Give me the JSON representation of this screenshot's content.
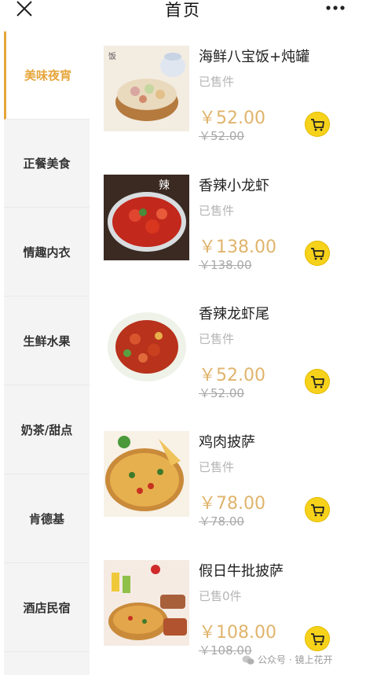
{
  "header": {
    "title": "首页",
    "close_icon": "close-icon",
    "more_icon": "more-icon"
  },
  "sidebar": {
    "items": [
      {
        "label": "美味夜宵",
        "active": true
      },
      {
        "label": "正餐美食",
        "active": false
      },
      {
        "label": "情趣内衣",
        "active": false
      },
      {
        "label": "生鲜水果",
        "active": false
      },
      {
        "label": "奶茶/甜点",
        "active": false
      },
      {
        "label": "肯德基",
        "active": false
      },
      {
        "label": "酒店民宿",
        "active": false
      }
    ],
    "accent_color": "#e6a53a"
  },
  "products": [
    {
      "name": "海鲜八宝饭+炖罐",
      "sold": "已售件",
      "price": "￥52.00",
      "original_price": "￥52.00",
      "image": "seafood-rice-image"
    },
    {
      "name": "香辣小龙虾",
      "sold": "已售件",
      "price": "￥138.00",
      "original_price": "￥138.00",
      "image": "crayfish-image"
    },
    {
      "name": "香辣龙虾尾",
      "sold": "已售件",
      "price": "￥52.00",
      "original_price": "￥52.00",
      "image": "crayfish-tail-image"
    },
    {
      "name": "鸡肉披萨",
      "sold": "已售件",
      "price": "￥78.00",
      "original_price": "￥78.00",
      "image": "chicken-pizza-image"
    },
    {
      "name": "假日牛批披萨",
      "sold": "已售0件",
      "price": "￥108.00",
      "original_price": "￥108.00",
      "image": "holiday-pizza-image"
    }
  ],
  "watermark": {
    "text": "公众号 · 镜上花开",
    "icon": "wechat-icon"
  },
  "colors": {
    "price": "#e0b46c",
    "cart": "#f7d21a"
  }
}
